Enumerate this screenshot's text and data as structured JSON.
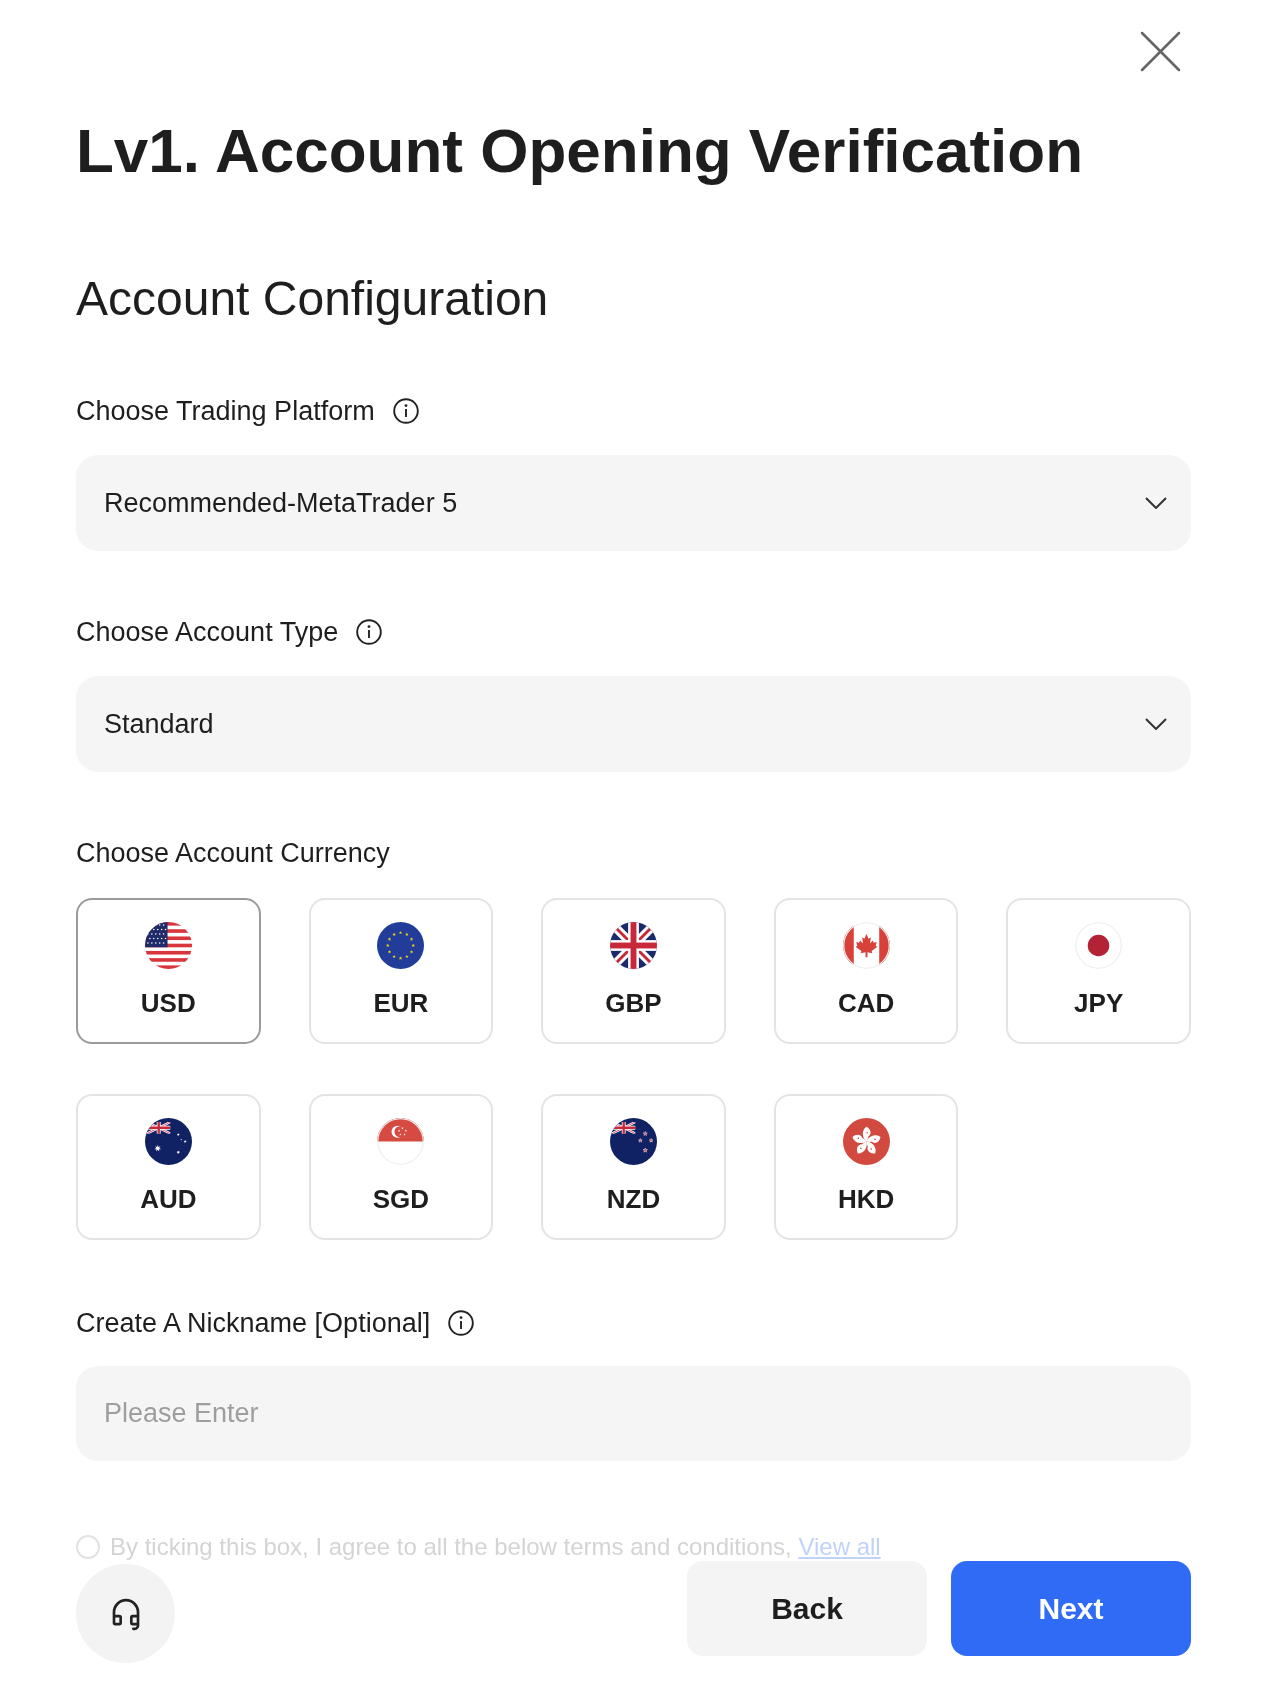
{
  "title": "Lv1. Account Opening Verification",
  "section_title": "Account Configuration",
  "platform": {
    "label": "Choose Trading Platform",
    "value": "Recommended-MetaTrader 5"
  },
  "account_type": {
    "label": "Choose Account Type",
    "value": "Standard"
  },
  "currency": {
    "label": "Choose Account Currency",
    "options": [
      {
        "code": "USD",
        "selected": true
      },
      {
        "code": "EUR",
        "selected": false
      },
      {
        "code": "GBP",
        "selected": false
      },
      {
        "code": "CAD",
        "selected": false
      },
      {
        "code": "JPY",
        "selected": false
      },
      {
        "code": "AUD",
        "selected": false
      },
      {
        "code": "SGD",
        "selected": false
      },
      {
        "code": "NZD",
        "selected": false
      },
      {
        "code": "HKD",
        "selected": false
      }
    ]
  },
  "nickname": {
    "label": "Create A Nickname [Optional]",
    "placeholder": "Please Enter"
  },
  "agreement": {
    "text": "By ticking this box, I agree to all the below terms and conditions,",
    "link": "View all",
    "checked": false
  },
  "buttons": [
    {
      "label": "Back",
      "kind": "secondary"
    },
    {
      "label": "Next",
      "kind": "primary"
    }
  ]
}
